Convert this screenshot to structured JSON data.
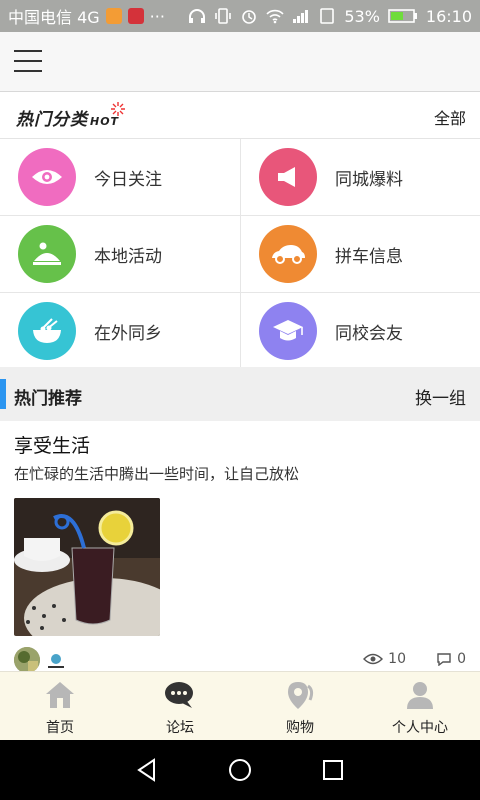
{
  "status_bar": {
    "carrier": "中国电信 4G",
    "extra": "···",
    "battery": "53%",
    "time": "16:10"
  },
  "hot_categories": {
    "title": "热门分类",
    "badge": "HOT",
    "all_label": "全部",
    "items": [
      {
        "label": "今日关注",
        "icon": "eye-icon",
        "color": "#f06cc0"
      },
      {
        "label": "同城爆料",
        "icon": "megaphone-icon",
        "color": "#e8567a"
      },
      {
        "label": "本地活动",
        "icon": "activity-icon",
        "color": "#66c14a"
      },
      {
        "label": "拼车信息",
        "icon": "car-icon",
        "color": "#ef8a33"
      },
      {
        "label": "在外同乡",
        "icon": "bowl-icon",
        "color": "#36c4d4"
      },
      {
        "label": "同校会友",
        "icon": "graduation-cap-icon",
        "color": "#8e82f0"
      }
    ]
  },
  "recommend": {
    "title": "热门推荐",
    "switch_label": "换一组"
  },
  "post": {
    "title": "享受生活",
    "description": "在忙碌的生活中腾出一些时间，让自己放松",
    "views": "10",
    "comments": "0"
  },
  "tabbar": {
    "items": [
      {
        "label": "首页",
        "icon": "home-icon"
      },
      {
        "label": "论坛",
        "icon": "forum-icon"
      },
      {
        "label": "购物",
        "icon": "shopping-location-icon"
      },
      {
        "label": "个人中心",
        "icon": "user-icon"
      }
    ]
  },
  "colors": {
    "accent_blue": "#2b95f0",
    "tabbar_bg": "#fbf8e8",
    "status_bar_bg": "#a7a8a5"
  }
}
